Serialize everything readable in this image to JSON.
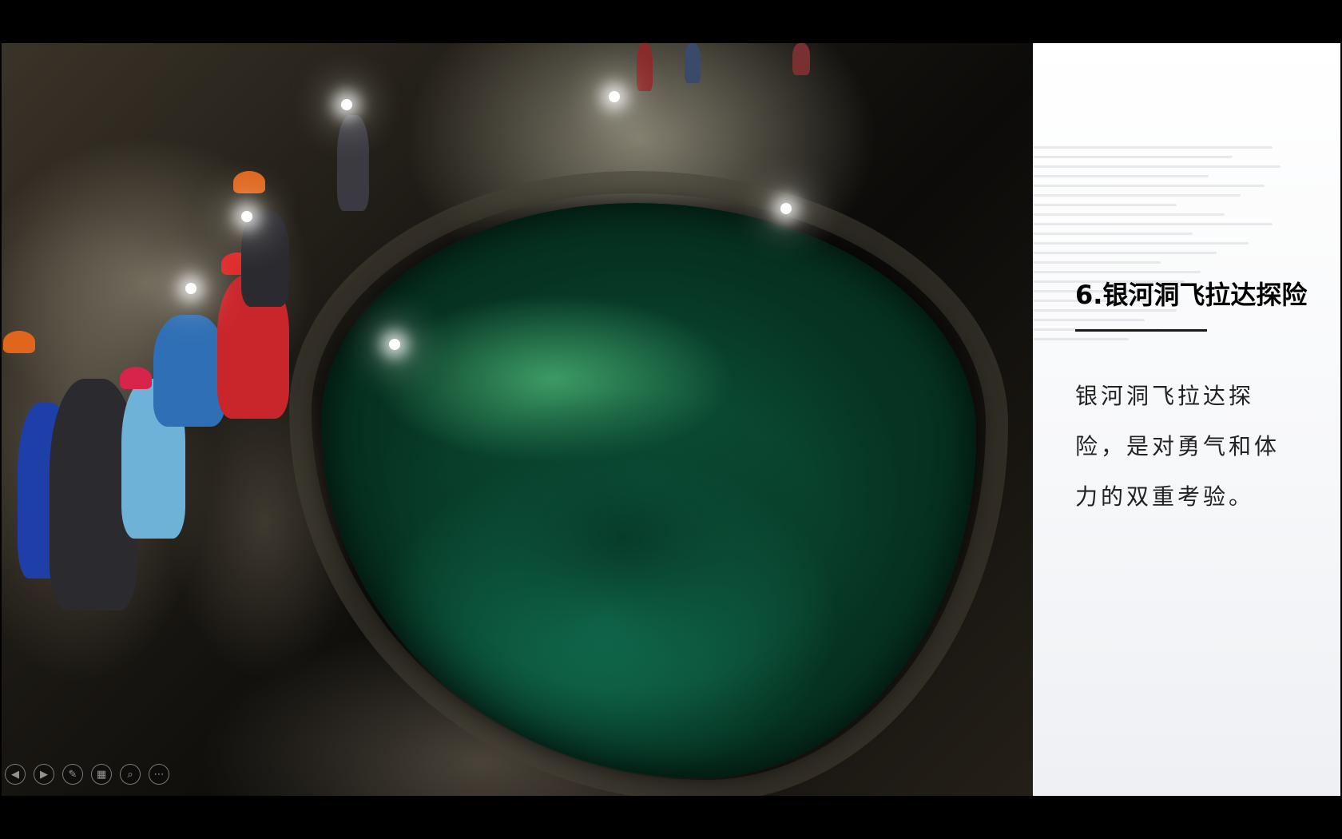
{
  "slide": {
    "title": "6.银河洞飞拉达探险",
    "body": "银河洞飞拉达探险，是对勇气和体力的双重考验。"
  },
  "photo": {
    "subject": "cave-pool-photo"
  },
  "controls": {
    "prev_icon": "◀",
    "next_icon": "▶",
    "pen_icon": "✎",
    "slides_icon": "▦",
    "zoom_icon": "⌕",
    "more_icon": "⋯"
  }
}
